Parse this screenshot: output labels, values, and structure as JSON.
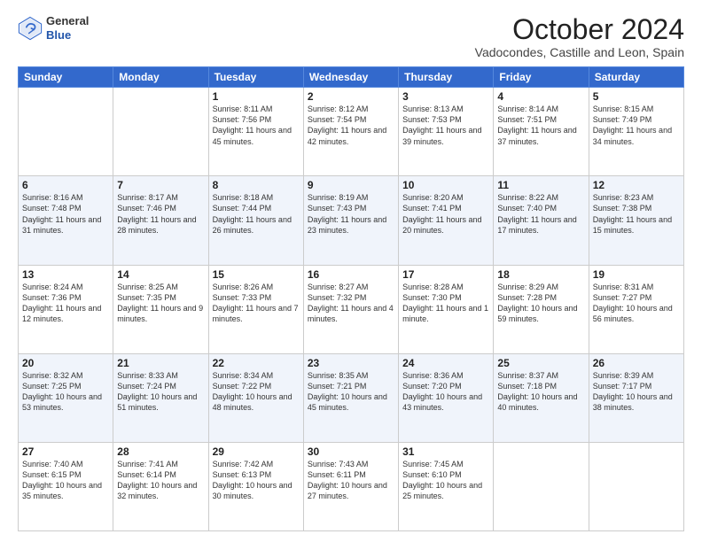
{
  "header": {
    "logo_line1": "General",
    "logo_line2": "Blue",
    "month": "October 2024",
    "location": "Vadocondes, Castille and Leon, Spain"
  },
  "weekdays": [
    "Sunday",
    "Monday",
    "Tuesday",
    "Wednesday",
    "Thursday",
    "Friday",
    "Saturday"
  ],
  "weeks": [
    [
      {
        "day": "",
        "info": ""
      },
      {
        "day": "",
        "info": ""
      },
      {
        "day": "1",
        "info": "Sunrise: 8:11 AM\nSunset: 7:56 PM\nDaylight: 11 hours and 45 minutes."
      },
      {
        "day": "2",
        "info": "Sunrise: 8:12 AM\nSunset: 7:54 PM\nDaylight: 11 hours and 42 minutes."
      },
      {
        "day": "3",
        "info": "Sunrise: 8:13 AM\nSunset: 7:53 PM\nDaylight: 11 hours and 39 minutes."
      },
      {
        "day": "4",
        "info": "Sunrise: 8:14 AM\nSunset: 7:51 PM\nDaylight: 11 hours and 37 minutes."
      },
      {
        "day": "5",
        "info": "Sunrise: 8:15 AM\nSunset: 7:49 PM\nDaylight: 11 hours and 34 minutes."
      }
    ],
    [
      {
        "day": "6",
        "info": "Sunrise: 8:16 AM\nSunset: 7:48 PM\nDaylight: 11 hours and 31 minutes."
      },
      {
        "day": "7",
        "info": "Sunrise: 8:17 AM\nSunset: 7:46 PM\nDaylight: 11 hours and 28 minutes."
      },
      {
        "day": "8",
        "info": "Sunrise: 8:18 AM\nSunset: 7:44 PM\nDaylight: 11 hours and 26 minutes."
      },
      {
        "day": "9",
        "info": "Sunrise: 8:19 AM\nSunset: 7:43 PM\nDaylight: 11 hours and 23 minutes."
      },
      {
        "day": "10",
        "info": "Sunrise: 8:20 AM\nSunset: 7:41 PM\nDaylight: 11 hours and 20 minutes."
      },
      {
        "day": "11",
        "info": "Sunrise: 8:22 AM\nSunset: 7:40 PM\nDaylight: 11 hours and 17 minutes."
      },
      {
        "day": "12",
        "info": "Sunrise: 8:23 AM\nSunset: 7:38 PM\nDaylight: 11 hours and 15 minutes."
      }
    ],
    [
      {
        "day": "13",
        "info": "Sunrise: 8:24 AM\nSunset: 7:36 PM\nDaylight: 11 hours and 12 minutes."
      },
      {
        "day": "14",
        "info": "Sunrise: 8:25 AM\nSunset: 7:35 PM\nDaylight: 11 hours and 9 minutes."
      },
      {
        "day": "15",
        "info": "Sunrise: 8:26 AM\nSunset: 7:33 PM\nDaylight: 11 hours and 7 minutes."
      },
      {
        "day": "16",
        "info": "Sunrise: 8:27 AM\nSunset: 7:32 PM\nDaylight: 11 hours and 4 minutes."
      },
      {
        "day": "17",
        "info": "Sunrise: 8:28 AM\nSunset: 7:30 PM\nDaylight: 11 hours and 1 minute."
      },
      {
        "day": "18",
        "info": "Sunrise: 8:29 AM\nSunset: 7:28 PM\nDaylight: 10 hours and 59 minutes."
      },
      {
        "day": "19",
        "info": "Sunrise: 8:31 AM\nSunset: 7:27 PM\nDaylight: 10 hours and 56 minutes."
      }
    ],
    [
      {
        "day": "20",
        "info": "Sunrise: 8:32 AM\nSunset: 7:25 PM\nDaylight: 10 hours and 53 minutes."
      },
      {
        "day": "21",
        "info": "Sunrise: 8:33 AM\nSunset: 7:24 PM\nDaylight: 10 hours and 51 minutes."
      },
      {
        "day": "22",
        "info": "Sunrise: 8:34 AM\nSunset: 7:22 PM\nDaylight: 10 hours and 48 minutes."
      },
      {
        "day": "23",
        "info": "Sunrise: 8:35 AM\nSunset: 7:21 PM\nDaylight: 10 hours and 45 minutes."
      },
      {
        "day": "24",
        "info": "Sunrise: 8:36 AM\nSunset: 7:20 PM\nDaylight: 10 hours and 43 minutes."
      },
      {
        "day": "25",
        "info": "Sunrise: 8:37 AM\nSunset: 7:18 PM\nDaylight: 10 hours and 40 minutes."
      },
      {
        "day": "26",
        "info": "Sunrise: 8:39 AM\nSunset: 7:17 PM\nDaylight: 10 hours and 38 minutes."
      }
    ],
    [
      {
        "day": "27",
        "info": "Sunrise: 7:40 AM\nSunset: 6:15 PM\nDaylight: 10 hours and 35 minutes."
      },
      {
        "day": "28",
        "info": "Sunrise: 7:41 AM\nSunset: 6:14 PM\nDaylight: 10 hours and 32 minutes."
      },
      {
        "day": "29",
        "info": "Sunrise: 7:42 AM\nSunset: 6:13 PM\nDaylight: 10 hours and 30 minutes."
      },
      {
        "day": "30",
        "info": "Sunrise: 7:43 AM\nSunset: 6:11 PM\nDaylight: 10 hours and 27 minutes."
      },
      {
        "day": "31",
        "info": "Sunrise: 7:45 AM\nSunset: 6:10 PM\nDaylight: 10 hours and 25 minutes."
      },
      {
        "day": "",
        "info": ""
      },
      {
        "day": "",
        "info": ""
      }
    ]
  ]
}
